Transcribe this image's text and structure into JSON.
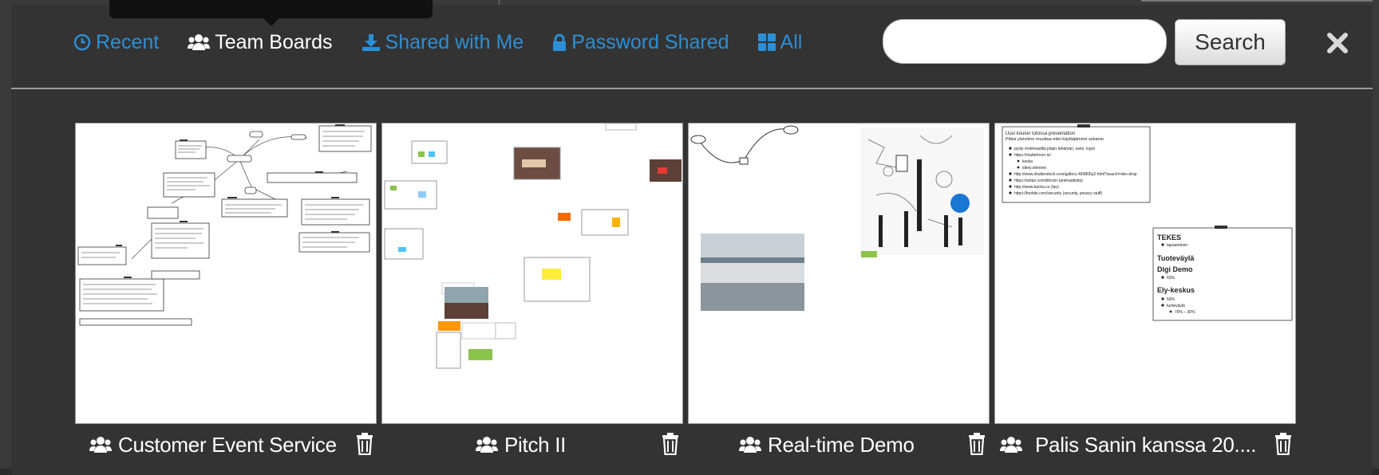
{
  "nav": {
    "recent": "Recent",
    "team_boards": "Team Boards",
    "shared_with_me": "Shared with Me",
    "password_shared": "Password Shared",
    "all": "All"
  },
  "search": {
    "placeholder": "",
    "button_label": "Search"
  },
  "boards": [
    {
      "title": "Customer Event Service"
    },
    {
      "title": "Pitch II"
    },
    {
      "title": "Real-time Demo"
    },
    {
      "title": "Palis Sanin kanssa 20...."
    }
  ],
  "thumb4": {
    "note1_heading": "Uusi koulun tutossa presentation",
    "note1_sub": "Pitäis yleisöine muuttaa ettei käyttäjämme sekanin",
    "note1_items": [
      "pysty molemadilla jotain tehämän, esim. logot",
      "https://matterhorn.io/",
      "keska",
      "stkey.elemine",
      "http://www.shutterstock.com/gallery-490806p2.html?search=dev-drop",
      "https://stripe.com/bitcoin-(animaatioita)",
      "http://www.backa.co (lau)",
      "https://foobits.com/security (security, privacy stuff)"
    ],
    "note2_tekes": "TEKES",
    "note2_tekes_item": "tapaaminen",
    "note2_tuote": "Tuoteväylä",
    "note2_digi": "Digi Demo",
    "note2_digi_item": "60%",
    "note2_ely": "Ely-keskus",
    "note2_ely_items": [
      "50%",
      "tuoteväylä",
      "70% – 30%"
    ]
  },
  "colors": {
    "accent": "#2b8fd6",
    "dialog_bg": "#333333"
  }
}
